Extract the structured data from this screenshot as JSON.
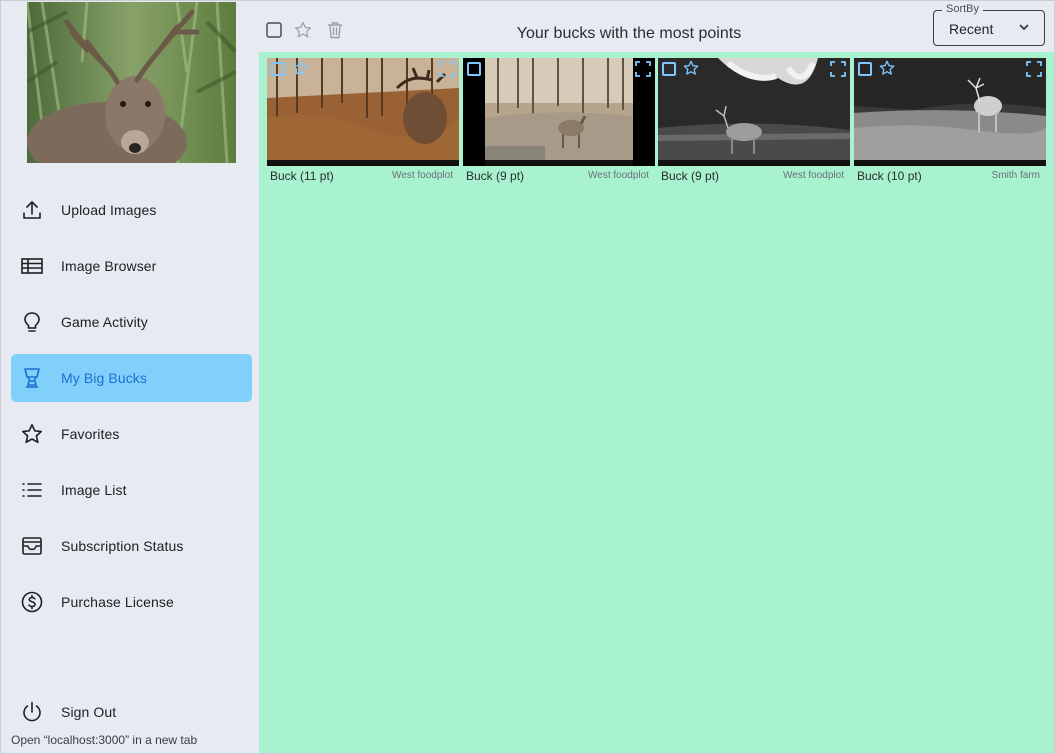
{
  "sidebar": {
    "profile_photo_alt": "deer",
    "items": [
      {
        "label": "Upload Images",
        "icon": "upload-icon"
      },
      {
        "label": "Image Browser",
        "icon": "table-icon"
      },
      {
        "label": "Game Activity",
        "icon": "lightbulb-icon"
      },
      {
        "label": "My Big Bucks",
        "icon": "trophy-icon",
        "active": true
      },
      {
        "label": "Favorites",
        "icon": "star-icon"
      },
      {
        "label": "Image List",
        "icon": "list-icon"
      },
      {
        "label": "Subscription Status",
        "icon": "subscription-icon"
      },
      {
        "label": "Purchase License",
        "icon": "dollar-icon"
      }
    ],
    "sign_out_label": "Sign Out"
  },
  "toolbar": {
    "heading": "Your bucks with the most points",
    "sort_legend": "SortBy",
    "sort_value": "Recent"
  },
  "cards": [
    {
      "title": "Buck (11 pt)",
      "location": "West foodplot"
    },
    {
      "title": "Buck (9 pt)",
      "location": "West foodplot"
    },
    {
      "title": "Buck (9 pt)",
      "location": "West foodplot"
    },
    {
      "title": "Buck (10 pt)",
      "location": "Smith farm"
    }
  ],
  "status_bar": {
    "url_hint": "Open “localhost:3000” in a new tab"
  },
  "colors": {
    "accent": "#81d0fb",
    "accent_text": "#1c6fd1",
    "grid_background": "#a8f2cf",
    "sidebar_background": "#e8eaf1"
  }
}
